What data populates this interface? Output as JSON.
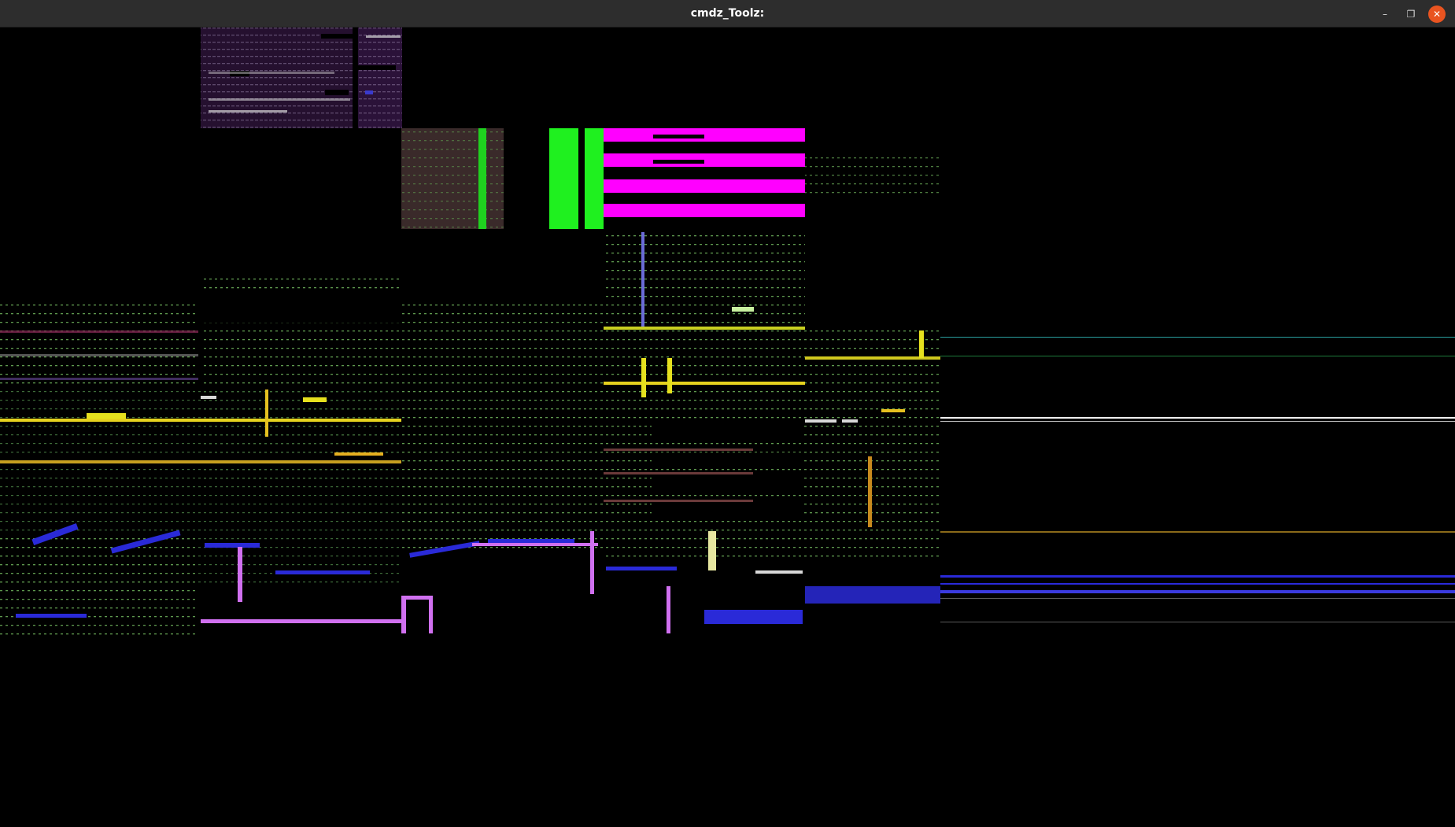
{
  "window": {
    "title": "cmdz_Toolz:",
    "controls": {
      "minimize": "–",
      "maximize": "❐",
      "close": "✕"
    }
  },
  "colors": {
    "titlebar": "#2d2d2d",
    "background": "#000000",
    "close_button": "#e95420",
    "dotted_grid": "#4f7f4f",
    "magenta": "#ff00ff",
    "green": "#00ff00",
    "yellow": "#e6d21e",
    "purple_panel": "#2a0f3a",
    "blue_glyph": "#2a2ad8",
    "violet": "#d070f0"
  }
}
